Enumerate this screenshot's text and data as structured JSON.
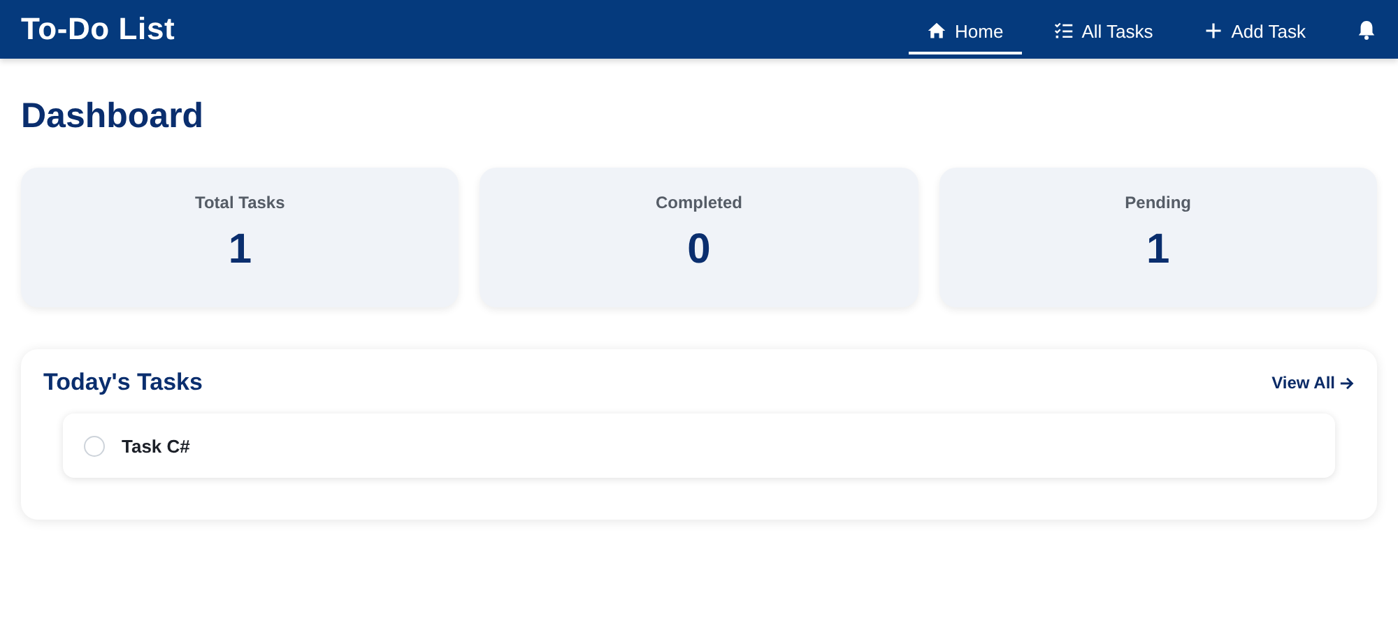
{
  "app_title": "To-Do List",
  "nav": [
    {
      "label": "Home",
      "kind": "home",
      "selected": true
    },
    {
      "label": "All Tasks",
      "kind": "list",
      "selected": false
    },
    {
      "label": "Add Task",
      "kind": "add",
      "selected": false
    }
  ],
  "page_title": "Dashboard",
  "stats": [
    {
      "label": "Total Tasks",
      "value": "1"
    },
    {
      "label": "Completed",
      "value": "0"
    },
    {
      "label": "Pending",
      "value": "1"
    }
  ],
  "today": {
    "title": "Today's Tasks",
    "link": "View All",
    "tasks": [
      {
        "title": "Task C#",
        "checked": false
      }
    ]
  }
}
